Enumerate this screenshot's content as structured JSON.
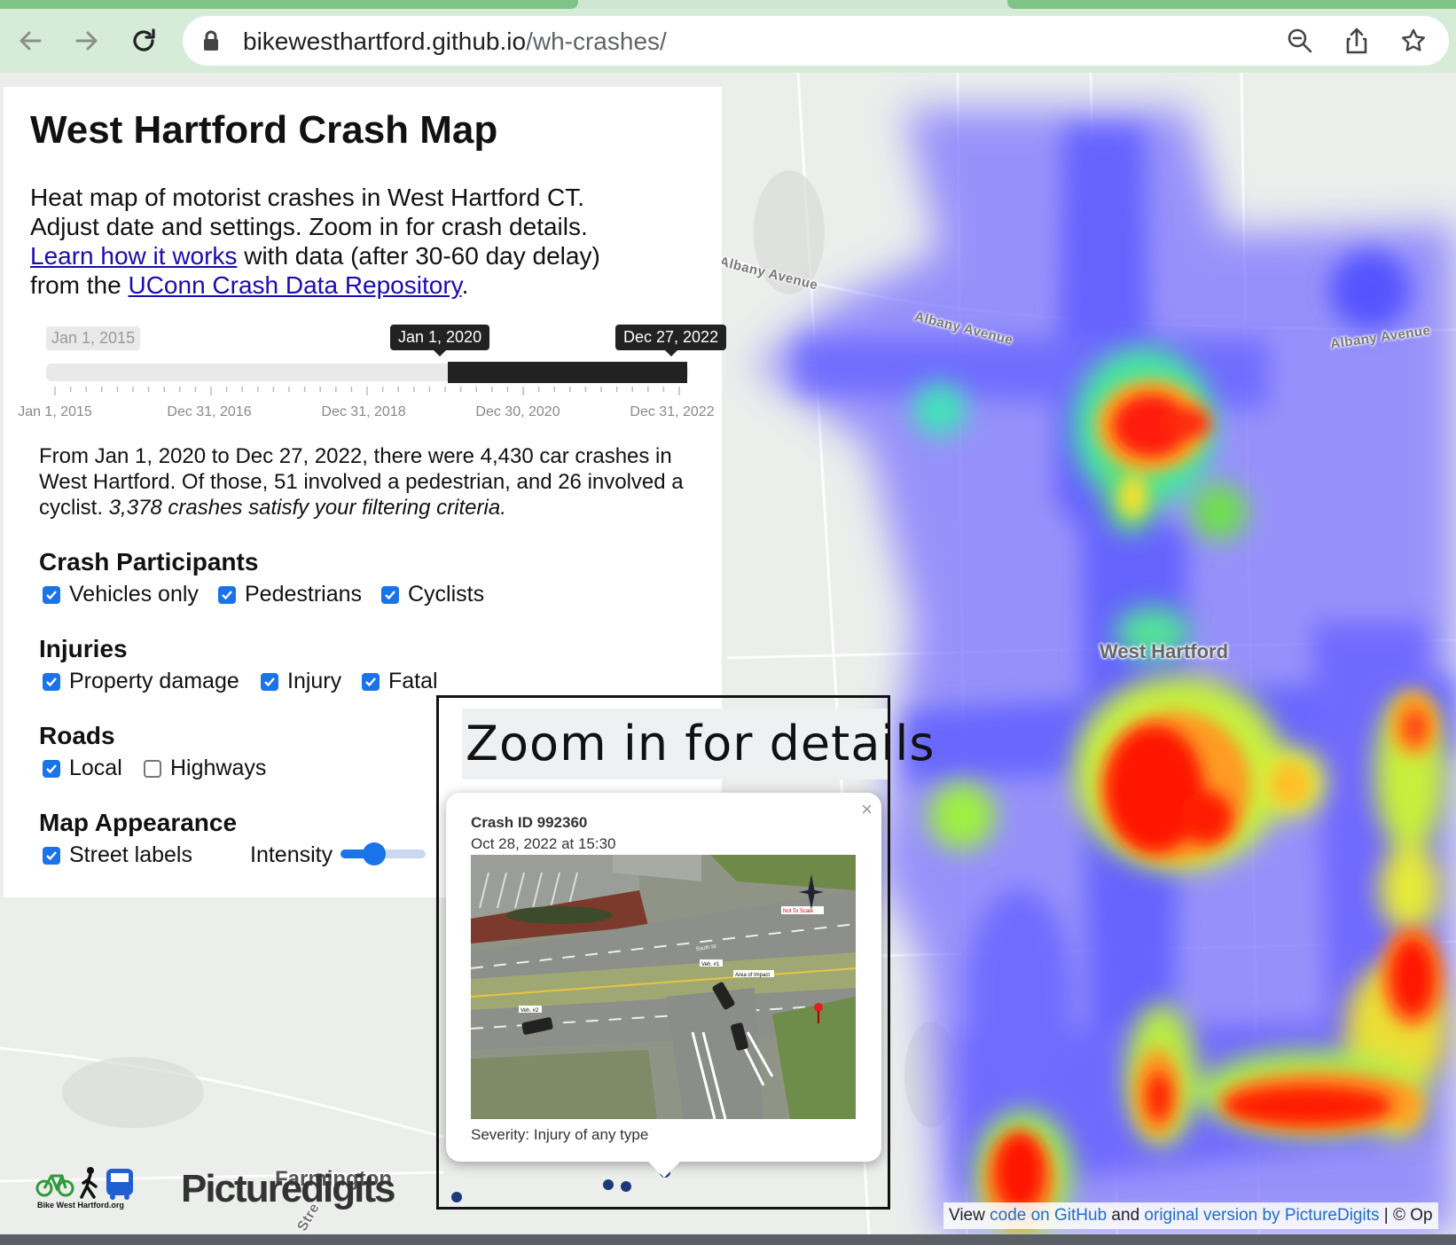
{
  "browser": {
    "url_host": "bikewesthartford.github.io",
    "url_path": "/wh-crashes/",
    "icons": [
      "back-arrow-icon",
      "forward-arrow-icon",
      "reload-icon",
      "lock-icon",
      "zoom-icon",
      "share-icon",
      "bookmark-star-icon"
    ]
  },
  "panel": {
    "title": "West Hartford Crash Map",
    "intro_line1": "Heat map of motorist crashes in West Hartford CT.",
    "intro_line2": "Adjust date and settings. Zoom in for crash details.",
    "learn_link": "Learn how it works",
    "intro_mid": " with data (after 30-60 day delay)",
    "intro_from": "from the ",
    "uconn_link": "UConn Crash Data Repository",
    "intro_end": "."
  },
  "date_slider": {
    "min_label": "Jan 1, 2015",
    "start_label": "Jan 1, 2020",
    "end_label": "Dec 27, 2022",
    "tick_labels": [
      "Jan 1, 2015",
      "Dec 31, 2016",
      "Dec 31, 2018",
      "Dec 30, 2020",
      "Dec 31, 2022"
    ],
    "selected_start_fraction": 0.625,
    "selected_end_fraction": 0.998
  },
  "summary": {
    "text": "From Jan 1, 2020 to Dec 27, 2022, there were 4,430 car crashes in West Hartford. Of those, 51 involved a pedestrian, and 26 involved a cyclist. ",
    "italic": "3,378 crashes satisfy your filtering criteria."
  },
  "filters": {
    "participants_title": "Crash Participants",
    "participants": [
      {
        "label": "Vehicles only",
        "checked": true
      },
      {
        "label": "Pedestrians",
        "checked": true
      },
      {
        "label": "Cyclists",
        "checked": true
      }
    ],
    "injuries_title": "Injuries",
    "injuries": [
      {
        "label": "Property damage",
        "checked": true
      },
      {
        "label": "Injury",
        "checked": true
      },
      {
        "label": "Fatal",
        "checked": true
      }
    ],
    "roads_title": "Roads",
    "roads": [
      {
        "label": "Local",
        "checked": true
      },
      {
        "label": "Highways",
        "checked": false
      }
    ],
    "appearance_title": "Map Appearance",
    "street_labels": {
      "label": "Street labels",
      "checked": true
    },
    "intensity_label": "Intensity",
    "intensity_fraction": 0.4
  },
  "map": {
    "street_labels": [
      "Albany Avenue",
      "Albany Avenue",
      "Albany Avenue",
      "Farmington"
    ],
    "town_label": "West Hartford",
    "partial_label": "Stre"
  },
  "callout": {
    "heading": "Zoom in for details"
  },
  "popup": {
    "crash_id": "Crash ID 992360",
    "date": "Oct 28, 2022 at 15:30",
    "severity": "Severity: Injury of any type",
    "close": "×",
    "diagram_labels": {
      "vehicle1": "Veh. #1",
      "vehicle2": "Veh. #2",
      "impact": "Area of Impact",
      "scale": "Not To Scale",
      "street": "South St"
    }
  },
  "logos": {
    "bwh_text": "Bike West Hartford.org",
    "picturedigits": "Picturedigits"
  },
  "attribution": {
    "prefix": "View ",
    "github_link": "code on GitHub",
    "and": " and ",
    "original_link": "original version by PictureDigits",
    "suffix": " | © Op"
  }
}
